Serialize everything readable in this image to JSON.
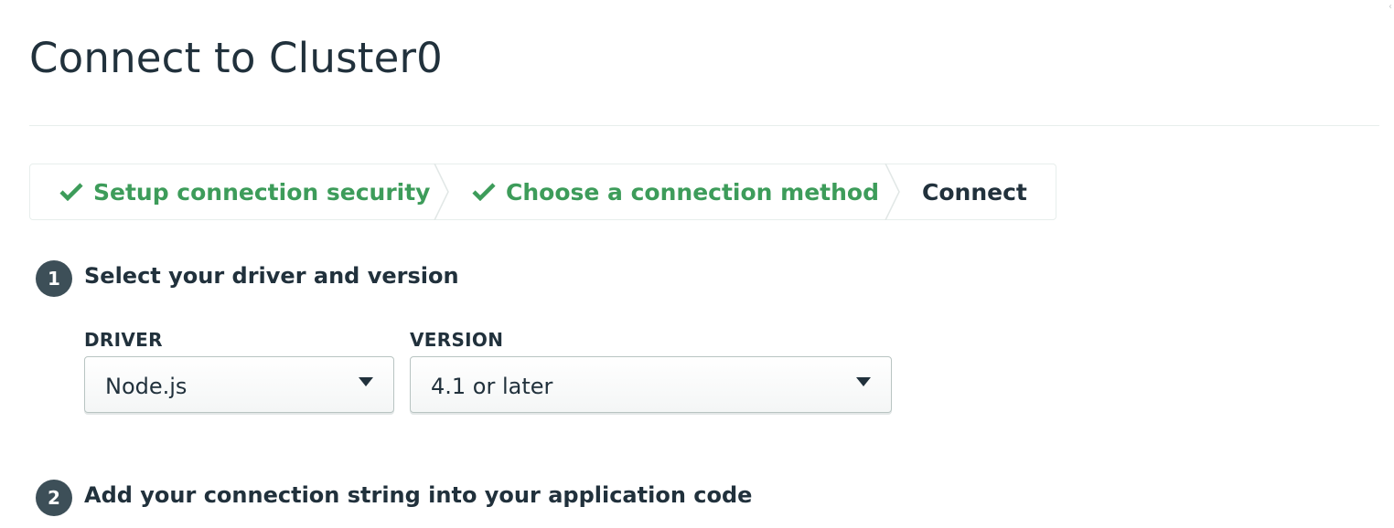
{
  "header": {
    "title": "Connect to Cluster0"
  },
  "stepper": {
    "steps": [
      {
        "label": "Setup connection security",
        "state": "done"
      },
      {
        "label": "Choose a connection method",
        "state": "done"
      },
      {
        "label": "Connect",
        "state": "current"
      }
    ],
    "done_icon": "check-icon",
    "done_color": "#3d9c5a"
  },
  "section1": {
    "number": "1",
    "title": "Select your driver and version",
    "driver": {
      "label": "DRIVER",
      "value": "Node.js"
    },
    "version": {
      "label": "VERSION",
      "value": "4.1 or later"
    }
  },
  "section2": {
    "number": "2",
    "title": "Add your connection string into your application code"
  },
  "colors": {
    "text": "#21313c",
    "badge": "#3d4f58",
    "success": "#3d9c5a",
    "border": "#e7eeec"
  }
}
